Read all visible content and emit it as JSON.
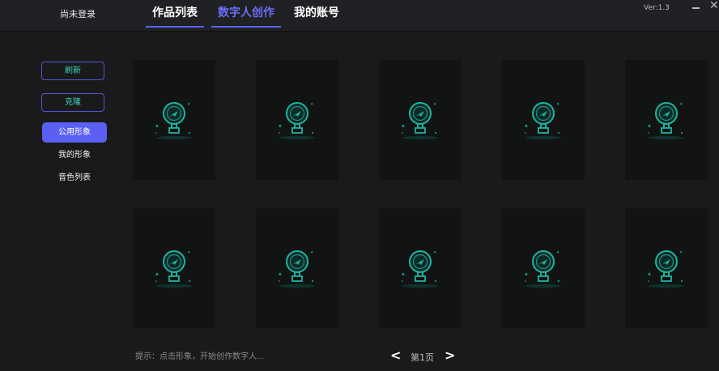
{
  "header": {
    "login_status": "尚未登录",
    "tabs": [
      {
        "label": "作品列表"
      },
      {
        "label": "数字人创作"
      },
      {
        "label": "我的账号"
      }
    ],
    "version": "Ver:1.3"
  },
  "sidebar": {
    "refresh_label": "刷新",
    "clone_label": "克隆",
    "items": [
      {
        "label": "公用形象"
      },
      {
        "label": "我的形象"
      },
      {
        "label": "音色列表"
      }
    ]
  },
  "gallery": {
    "placeholder_icon": "lightbulb-placeholder-icon",
    "card_count": 10
  },
  "footer": {
    "hint": "提示：点击形象，开始创作数字人...",
    "page_label": "第1页",
    "prev_symbol": "<",
    "next_symbol": ">"
  },
  "colors": {
    "accent": "#5b60f3",
    "teal": "#1fb3a3",
    "background": "#1a1a1b",
    "card": "#121413"
  }
}
